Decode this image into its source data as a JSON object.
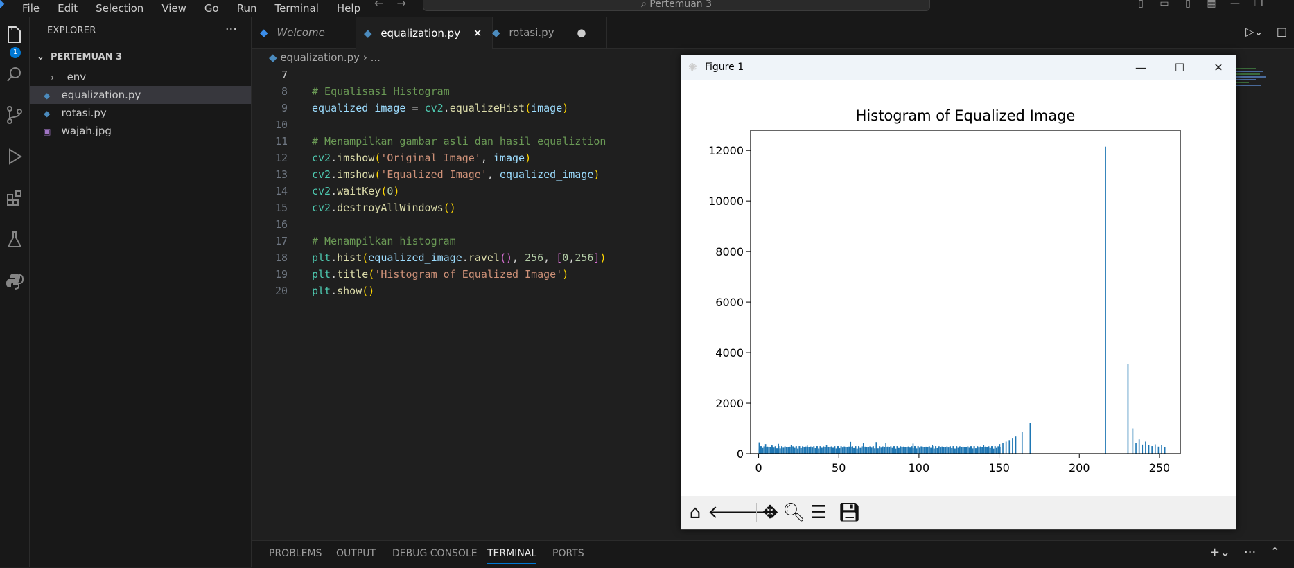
{
  "menu": {
    "items": [
      "File",
      "Edit",
      "Selection",
      "View",
      "Go",
      "Run",
      "Terminal",
      "Help"
    ],
    "search_text": "Pertemuan 3"
  },
  "activity_bar": {
    "badge": "1"
  },
  "sidebar": {
    "title": "EXPLORER",
    "more": "···",
    "folder": "PERTEMUAN 3",
    "items": [
      {
        "label": "env",
        "icon": "chevron-right-icon"
      },
      {
        "label": "equalization.py",
        "icon": "python-file-icon"
      },
      {
        "label": "rotasi.py",
        "icon": "python-file-icon"
      },
      {
        "label": "wajah.jpg",
        "icon": "image-file-icon"
      }
    ]
  },
  "tabs": [
    {
      "label": "Welcome",
      "icon": "vscode-icon"
    },
    {
      "label": "equalization.py",
      "icon": "python-file-icon",
      "close": "✕"
    },
    {
      "label": "rotasi.py",
      "icon": "python-file-icon",
      "dirty": "●"
    }
  ],
  "breadcrumb": {
    "file": "equalization.py",
    "rest": "..."
  },
  "code": {
    "line_numbers": [
      "7",
      "8",
      "9",
      "10",
      "11",
      "12",
      "13",
      "14",
      "15",
      "16",
      "17",
      "18",
      "19",
      "20"
    ],
    "l8": "# Equalisasi Histogram",
    "l9": [
      "equalized_image",
      " = ",
      "cv2",
      ".",
      "equalizeHist",
      "(",
      "image",
      ")"
    ],
    "l11": "# Menampilkan gambar asli dan hasil equaliztion",
    "l12": [
      "cv2",
      ".",
      "imshow",
      "(",
      "'Original Image'",
      ", ",
      "image",
      ")"
    ],
    "l13": [
      "cv2",
      ".",
      "imshow",
      "(",
      "'Equalized Image'",
      ", ",
      "equalized_image",
      ")"
    ],
    "l14": [
      "cv2",
      ".",
      "waitKey",
      "(",
      "0",
      ")"
    ],
    "l15": [
      "cv2",
      ".",
      "destroyAllWindows",
      "()"
    ],
    "l17": "# Menampilkan histogram",
    "l18": [
      "plt",
      ".",
      "hist",
      "(",
      "equalized_image",
      ".",
      "ravel",
      "()",
      ", ",
      "256",
      ", ",
      "[",
      "0",
      ",",
      "256",
      "]",
      ")"
    ],
    "l19": [
      "plt",
      ".",
      "title",
      "(",
      "'Histogram of Equalized Image'",
      ")"
    ],
    "l20": [
      "plt",
      ".",
      "show",
      "()"
    ]
  },
  "panel": {
    "tabs": [
      "PROBLEMS",
      "OUTPUT",
      "DEBUG CONSOLE",
      "TERMINAL",
      "PORTS"
    ],
    "active": "TERMINAL"
  },
  "figure": {
    "window_title": "Figure 1",
    "toolbar": [
      "home-icon",
      "back-arrow-icon",
      "forward-arrow-icon",
      "pan-icon",
      "zoom-icon",
      "configure-subplots-icon",
      "save-icon"
    ]
  },
  "chart_data": {
    "type": "bar",
    "title": "Histogram of Equalized Image",
    "xlabel": "",
    "ylabel": "",
    "xlim": [
      -5,
      263
    ],
    "ylim": [
      0,
      12800
    ],
    "xticks": [
      "0",
      "50",
      "100",
      "150",
      "200",
      "250"
    ],
    "yticks": [
      "0",
      "2000",
      "4000",
      "6000",
      "8000",
      "10000",
      "12000"
    ],
    "color": "#1f77b4",
    "spikes": [
      {
        "x": 0,
        "value": 450
      },
      {
        "x": 4,
        "value": 380
      },
      {
        "x": 8,
        "value": 350
      },
      {
        "x": 12,
        "value": 390
      },
      {
        "x": 20,
        "value": 330
      },
      {
        "x": 30,
        "value": 320
      },
      {
        "x": 42,
        "value": 330
      },
      {
        "x": 57,
        "value": 470
      },
      {
        "x": 65,
        "value": 430
      },
      {
        "x": 73,
        "value": 460
      },
      {
        "x": 79,
        "value": 420
      },
      {
        "x": 96,
        "value": 400
      },
      {
        "x": 108,
        "value": 330
      },
      {
        "x": 140,
        "value": 330
      },
      {
        "x": 150,
        "value": 380
      },
      {
        "x": 152,
        "value": 430
      },
      {
        "x": 154,
        "value": 480
      },
      {
        "x": 156,
        "value": 540
      },
      {
        "x": 158,
        "value": 600
      },
      {
        "x": 160,
        "value": 680
      },
      {
        "x": 164,
        "value": 850
      },
      {
        "x": 169,
        "value": 1230
      },
      {
        "x": 216,
        "value": 12150
      },
      {
        "x": 230,
        "value": 3550
      },
      {
        "x": 233,
        "value": 1000
      },
      {
        "x": 235,
        "value": 420
      },
      {
        "x": 237,
        "value": 570
      },
      {
        "x": 239,
        "value": 360
      },
      {
        "x": 241,
        "value": 480
      },
      {
        "x": 243,
        "value": 350
      },
      {
        "x": 245,
        "value": 300
      },
      {
        "x": 247,
        "value": 370
      },
      {
        "x": 249,
        "value": 280
      },
      {
        "x": 251,
        "value": 330
      },
      {
        "x": 253,
        "value": 260
      }
    ],
    "baseline_level": 250,
    "baseline_range": [
      0,
      150
    ]
  }
}
